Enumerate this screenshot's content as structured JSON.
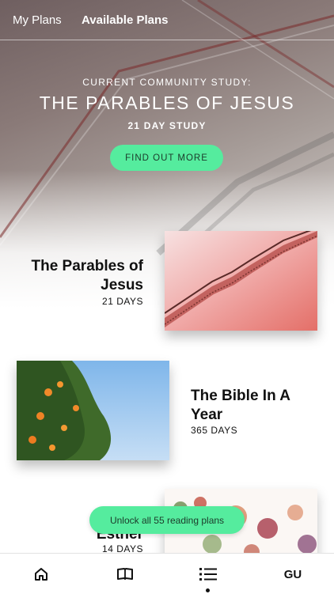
{
  "top_nav": {
    "tabs": [
      {
        "label": "My Plans"
      },
      {
        "label": "Available Plans"
      }
    ]
  },
  "hero": {
    "label": "CURRENT COMMUNITY STUDY:",
    "title": "THE PARABLES OF JESUS",
    "subtitle": "21 DAY STUDY",
    "cta": "FIND OUT MORE"
  },
  "plans": [
    {
      "title": "The Parables of Jesus",
      "days": "21 DAYS"
    },
    {
      "title": "The Bible In A Year",
      "days": "365 DAYS"
    },
    {
      "title": "Esther",
      "days": "14 DAYS"
    }
  ],
  "unlock_label": "Unlock all 55 reading plans",
  "bottom_nav": {
    "items": [
      {
        "icon": "home-icon"
      },
      {
        "icon": "book-icon"
      },
      {
        "icon": "list-icon"
      },
      {
        "label": "GU"
      }
    ],
    "active_index": 2
  },
  "colors": {
    "accent": "#55ec9e"
  }
}
